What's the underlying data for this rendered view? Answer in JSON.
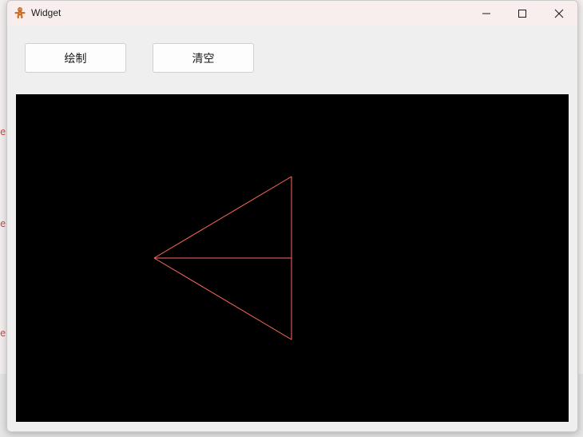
{
  "window": {
    "title": "Widget",
    "icon": "gingerbread-icon"
  },
  "controls": {
    "minimize_icon": "minimize-icon",
    "maximize_icon": "maximize-icon",
    "close_icon": "close-icon"
  },
  "toolbar": {
    "draw_label": "绘制",
    "clear_label": "清空"
  },
  "canvas": {
    "background": "#000000",
    "stroke_color": "#ff6a5a"
  }
}
